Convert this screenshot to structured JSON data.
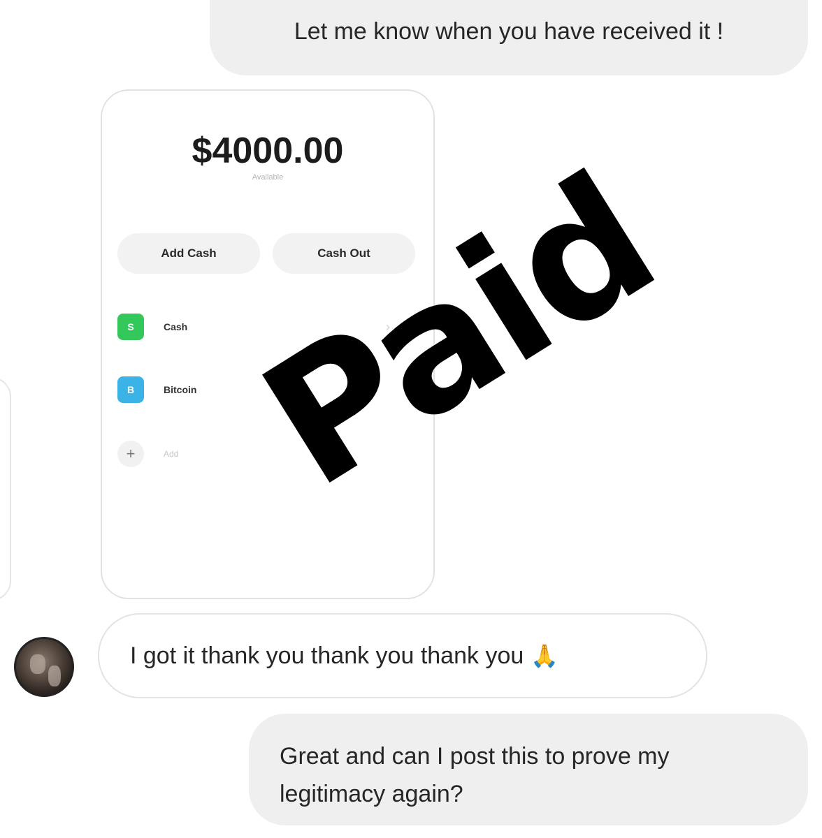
{
  "messages": {
    "outgoing_top": "Let me know when you have received it !",
    "incoming": "I got it thank you thank you thank you",
    "incoming_emoji": "🙏",
    "outgoing_bottom_line1": "Great and can I post this to prove my",
    "outgoing_bottom_line2": "legitimacy again?"
  },
  "attachment": {
    "balance": "$4000.00",
    "balance_caption": "Available",
    "buttons": {
      "add_cash": "Add Cash",
      "cash_out": "Cash Out"
    },
    "rows": [
      {
        "badge": "S",
        "label": "Cash",
        "color": "#34c759"
      },
      {
        "badge": "B",
        "label": "Bitcoin",
        "color": "#3bb3e6"
      },
      {
        "badge": "+",
        "label": "Add"
      }
    ],
    "chevron": "›"
  },
  "stamp": {
    "text": "Paid"
  },
  "icons": {
    "avatar": "user-avatar",
    "emoji": "folded-hands"
  }
}
